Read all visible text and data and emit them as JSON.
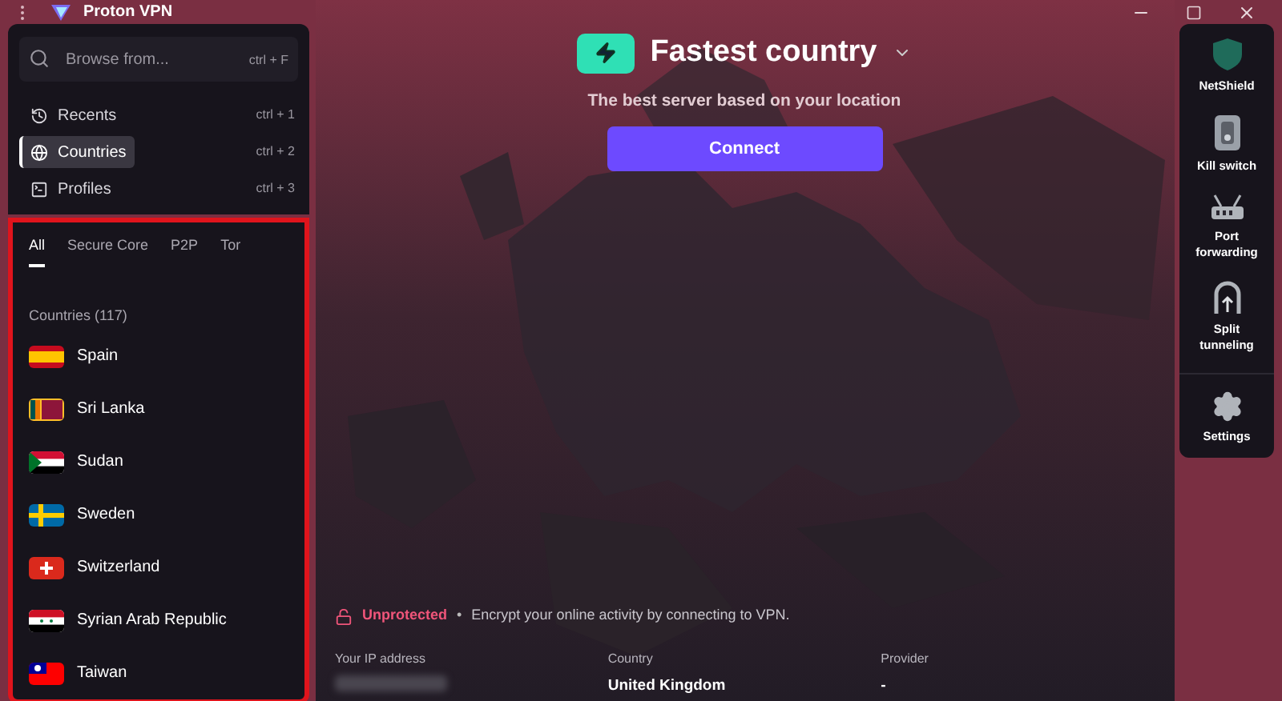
{
  "window": {
    "title": "Proton VPN"
  },
  "search": {
    "placeholder": "Browse from...",
    "shortcut": "ctrl + F"
  },
  "nav": [
    {
      "label": "Recents",
      "shortcut": "ctrl + 1",
      "selected": false
    },
    {
      "label": "Countries",
      "shortcut": "ctrl + 2",
      "selected": true
    },
    {
      "label": "Profiles",
      "shortcut": "ctrl + 3",
      "selected": false
    }
  ],
  "tabs": [
    {
      "label": "All",
      "selected": true
    },
    {
      "label": "Secure Core",
      "selected": false
    },
    {
      "label": "P2P",
      "selected": false
    },
    {
      "label": "Tor",
      "selected": false
    }
  ],
  "list_heading": "Countries (117)",
  "countries": [
    {
      "name": "Spain"
    },
    {
      "name": "Sri Lanka"
    },
    {
      "name": "Sudan"
    },
    {
      "name": "Sweden"
    },
    {
      "name": "Switzerland"
    },
    {
      "name": "Syrian Arab Republic"
    },
    {
      "name": "Taiwan"
    }
  ],
  "connection": {
    "title": "Fastest country",
    "subtitle": "The best server based on your location",
    "button": "Connect"
  },
  "status": {
    "state": "Unprotected",
    "separator": "•",
    "message": "Encrypt your online activity by connecting to VPN."
  },
  "info": [
    {
      "label": "Your IP address",
      "hidden": true
    },
    {
      "label": "Country",
      "value": "United Kingdom",
      "hidden": false
    },
    {
      "label": "Provider",
      "value": "-",
      "hidden": false
    }
  ],
  "features": [
    {
      "kind": "shield",
      "label": "NetShield"
    },
    {
      "kind": "killswitch",
      "label": "Kill switch"
    },
    {
      "kind": "router",
      "label": "Port forwarding"
    },
    {
      "kind": "split",
      "label": "Split tunneling"
    },
    {
      "kind": "gear",
      "label": "Settings"
    }
  ]
}
